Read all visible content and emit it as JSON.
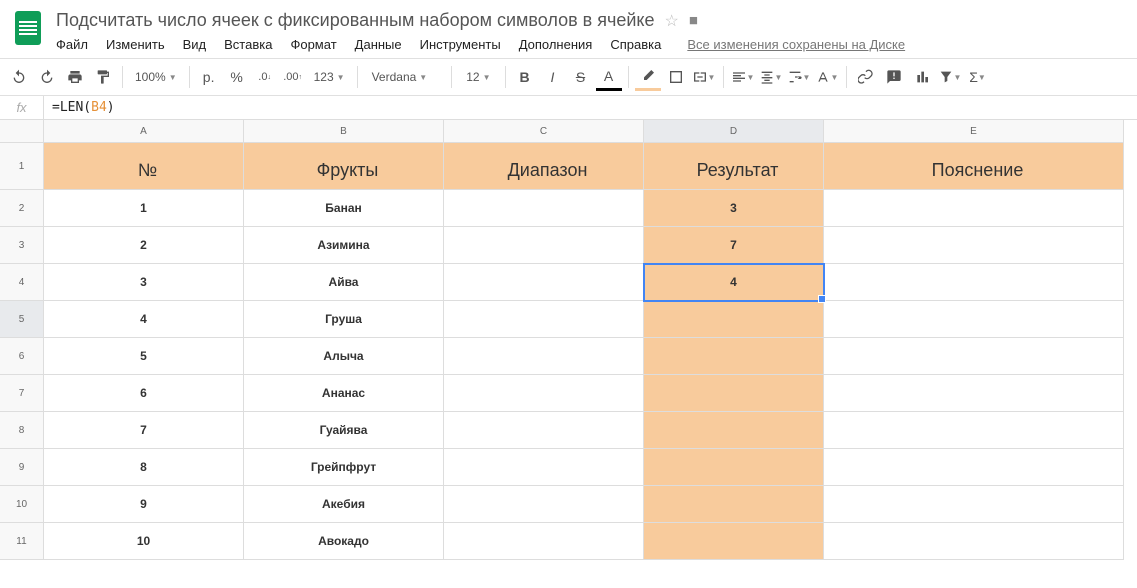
{
  "header": {
    "title": "Подсчитать число ячеек с фиксированным набором символов в ячейке",
    "save_status": "Все изменения сохранены на Диске"
  },
  "menu": {
    "file": "Файл",
    "edit": "Изменить",
    "view": "Вид",
    "insert": "Вставка",
    "format": "Формат",
    "data": "Данные",
    "tools": "Инструменты",
    "addons": "Дополнения",
    "help": "Справка"
  },
  "toolbar": {
    "zoom": "100%",
    "currency": "р.",
    "percent": "%",
    "dec_dec": ".0",
    "inc_dec": ".00",
    "more_fmt": "123",
    "font": "Verdana",
    "size": "12"
  },
  "formula": {
    "fx": "fx",
    "pre": "=LEN(",
    "ref": "B4",
    "post": ")"
  },
  "columns": [
    "A",
    "B",
    "C",
    "D",
    "E"
  ],
  "row_nums": [
    "1",
    "2",
    "3",
    "4",
    "5",
    "6",
    "7",
    "8",
    "9",
    "10",
    "11"
  ],
  "sheet": {
    "headers": {
      "a": "№",
      "b": "Фрукты",
      "c": "Диапазон",
      "d": "Результат",
      "e": "Пояснение"
    },
    "rows": [
      {
        "a": "1",
        "b": "Банан",
        "c": "",
        "d": "3",
        "e": ""
      },
      {
        "a": "2",
        "b": "Азимина",
        "c": "",
        "d": "7",
        "e": ""
      },
      {
        "a": "3",
        "b": "Айва",
        "c": "",
        "d": "4",
        "e": ""
      },
      {
        "a": "4",
        "b": "Груша",
        "c": "",
        "d": "",
        "e": ""
      },
      {
        "a": "5",
        "b": "Алыча",
        "c": "",
        "d": "",
        "e": ""
      },
      {
        "a": "6",
        "b": "Ананас",
        "c": "",
        "d": "",
        "e": ""
      },
      {
        "a": "7",
        "b": "Гуайява",
        "c": "",
        "d": "",
        "e": ""
      },
      {
        "a": "8",
        "b": "Грейпфрут",
        "c": "",
        "d": "",
        "e": ""
      },
      {
        "a": "9",
        "b": "Акебия",
        "c": "",
        "d": "",
        "e": ""
      },
      {
        "a": "10",
        "b": "Авокадо",
        "c": "",
        "d": "",
        "e": ""
      }
    ]
  },
  "selected": {
    "row": 3,
    "col": "d"
  }
}
